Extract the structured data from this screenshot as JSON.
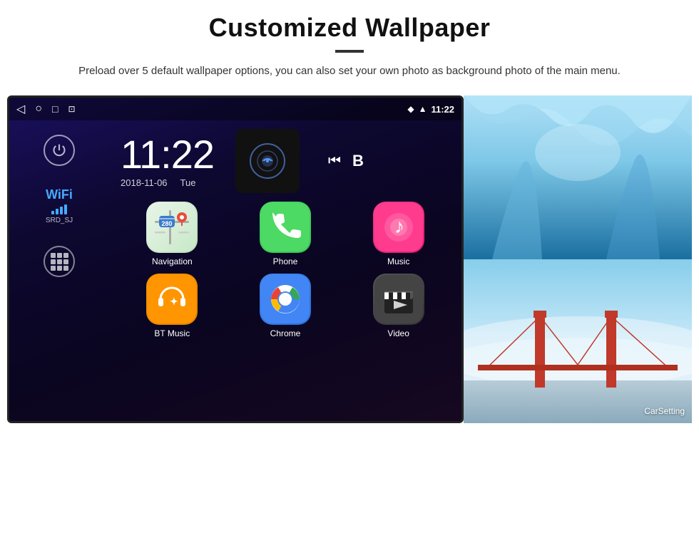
{
  "page": {
    "title": "Customized Wallpaper",
    "description": "Preload over 5 default wallpaper options, you can also set your own photo as background photo of the main menu."
  },
  "android": {
    "time": "11:22",
    "date": "2018-11-06",
    "day": "Tue",
    "wifi_label": "WiFi",
    "wifi_ssid": "SRD_SJ",
    "apps": [
      {
        "id": "navigation",
        "label": "Navigation"
      },
      {
        "id": "phone",
        "label": "Phone"
      },
      {
        "id": "music",
        "label": "Music"
      },
      {
        "id": "bt_music",
        "label": "BT Music"
      },
      {
        "id": "chrome",
        "label": "Chrome"
      },
      {
        "id": "video",
        "label": "Video"
      }
    ],
    "car_setting": "CarSetting",
    "status_time": "11:22"
  },
  "icons": {
    "power": "⏻",
    "back": "◁",
    "home": "○",
    "square": "□",
    "screenshot": "⊡",
    "location_pin": "📍",
    "wifi_signal": "▲",
    "signal_bars": "▌"
  }
}
